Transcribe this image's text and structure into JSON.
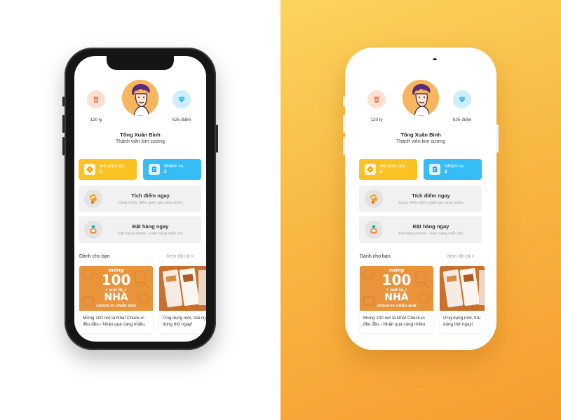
{
  "profile": {
    "name": "Tống Xuân Bình",
    "rank": "Thành viên kim cương",
    "cups": "120 ly",
    "points": "525 điểm"
  },
  "cards": {
    "coupon": {
      "label": "Mã giảm giá",
      "count": "5"
    },
    "mission": {
      "label": "Nhiệm vụ",
      "count": "2"
    }
  },
  "actions": {
    "earn": {
      "title": "Tích điểm ngay",
      "subtitle": "Càng nhiều điểm giảm giá càng nhiều"
    },
    "order": {
      "title": "Đặt hàng ngay",
      "subtitle": "Đặt hàng nhanh - Giao hàng miễn phí"
    }
  },
  "section": {
    "title": "Dành cho bạn",
    "see_all": "Xem tất cả >"
  },
  "promos": [
    {
      "image": {
        "line1": "mừng",
        "number": "100",
        "line2": "• nơi là •",
        "line3": "NHÀ",
        "tag": "check-in nhận quà"
      },
      "text_line1": "Mừng 100 nơi là Nhà! Check-in",
      "text_line2": "đều đều - Nhận quà càng nhiều."
    },
    {
      "text_line1": "Ứng dụng mới, trải ng",
      "text_line2": "dùng thử ngay!"
    }
  ],
  "colors": {
    "coupon": "#fcc221",
    "mission": "#37bdf5",
    "promo_orange": "#e9943b",
    "avatar_bg": "#f7b65d"
  }
}
